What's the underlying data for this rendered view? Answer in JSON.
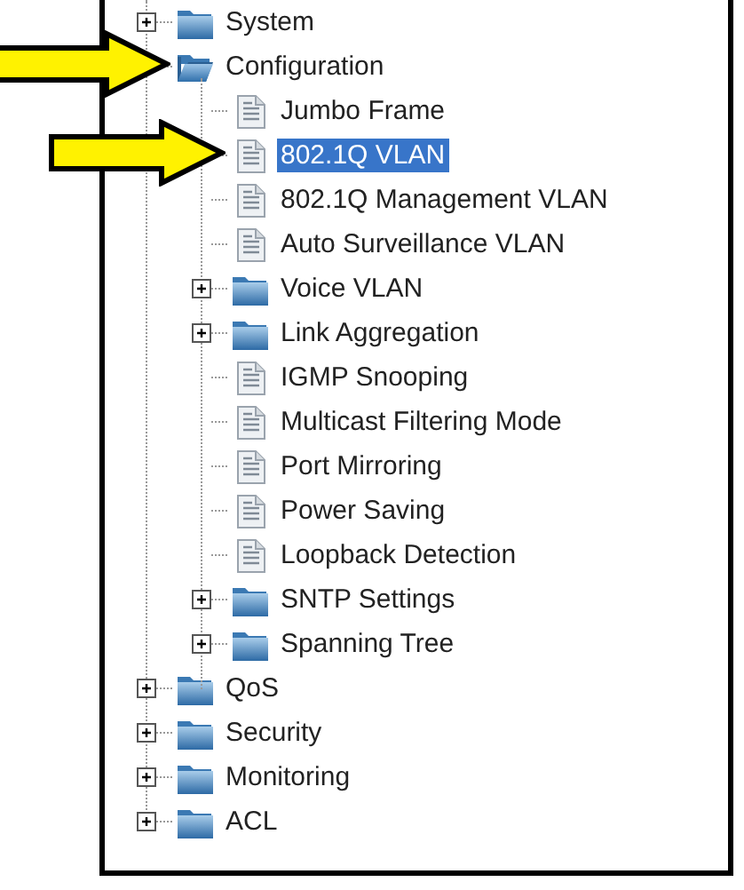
{
  "tree": [
    {
      "label": "System",
      "kind": "folder",
      "expanded": false,
      "selected": false,
      "pointer_arrow": false
    },
    {
      "label": "Configuration",
      "kind": "folder",
      "expanded": true,
      "selected": false,
      "pointer_arrow": true,
      "children": [
        {
          "label": "Jumbo Frame",
          "kind": "page",
          "selected": false,
          "pointer_arrow": false
        },
        {
          "label": "802.1Q VLAN",
          "kind": "page",
          "selected": true,
          "pointer_arrow": true
        },
        {
          "label": "802.1Q Management VLAN",
          "kind": "page",
          "selected": false,
          "pointer_arrow": false
        },
        {
          "label": "Auto Surveillance VLAN",
          "kind": "page",
          "selected": false,
          "pointer_arrow": false
        },
        {
          "label": "Voice VLAN",
          "kind": "folder",
          "expanded": false,
          "selected": false,
          "pointer_arrow": false
        },
        {
          "label": "Link Aggregation",
          "kind": "folder",
          "expanded": false,
          "selected": false,
          "pointer_arrow": false
        },
        {
          "label": "IGMP Snooping",
          "kind": "page",
          "selected": false,
          "pointer_arrow": false
        },
        {
          "label": "Multicast Filtering Mode",
          "kind": "page",
          "selected": false,
          "pointer_arrow": false
        },
        {
          "label": "Port Mirroring",
          "kind": "page",
          "selected": false,
          "pointer_arrow": false
        },
        {
          "label": "Power Saving",
          "kind": "page",
          "selected": false,
          "pointer_arrow": false
        },
        {
          "label": "Loopback Detection",
          "kind": "page",
          "selected": false,
          "pointer_arrow": false
        },
        {
          "label": "SNTP Settings",
          "kind": "folder",
          "expanded": false,
          "selected": false,
          "pointer_arrow": false
        },
        {
          "label": "Spanning Tree",
          "kind": "folder",
          "expanded": false,
          "selected": false,
          "pointer_arrow": false
        }
      ]
    },
    {
      "label": "QoS",
      "kind": "folder",
      "expanded": false,
      "selected": false,
      "pointer_arrow": false
    },
    {
      "label": "Security",
      "kind": "folder",
      "expanded": false,
      "selected": false,
      "pointer_arrow": false
    },
    {
      "label": "Monitoring",
      "kind": "folder",
      "expanded": false,
      "selected": false,
      "pointer_arrow": false
    },
    {
      "label": "ACL",
      "kind": "folder",
      "expanded": false,
      "selected": false,
      "pointer_arrow": false
    }
  ]
}
